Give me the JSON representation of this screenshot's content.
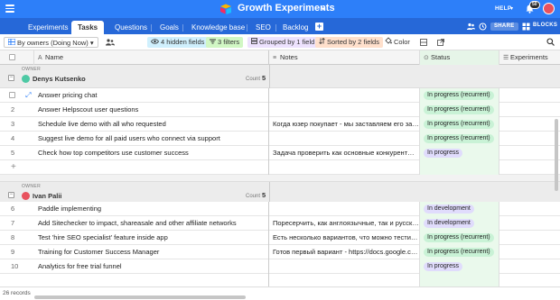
{
  "topbar": {
    "title": "Growth Experiments",
    "help_label": "HELP",
    "notification_count": "50"
  },
  "tabs": [
    {
      "label": "Experiments"
    },
    {
      "label": "Tasks"
    },
    {
      "label": "Questions"
    },
    {
      "label": "Goals"
    },
    {
      "label": "Knowledge base"
    },
    {
      "label": "SEO"
    },
    {
      "label": "Backlog"
    }
  ],
  "tabs_right": {
    "share_label": "SHARE",
    "blocks_label": "BLOCKS"
  },
  "toolbar": {
    "view_label": "By owners (Doing Now)",
    "hidden_fields": "4 hidden fields",
    "filters": "3 filters",
    "grouped": "Grouped by 1 field",
    "sorted": "Sorted by 2 fields",
    "color": "Color"
  },
  "columns": {
    "name": "Name",
    "notes": "Notes",
    "status": "Status",
    "experiments": "Experiments"
  },
  "groups": [
    {
      "owner_label": "OWNER",
      "owner": "Denys Kutsenko",
      "count_label": "Count",
      "count": "5",
      "avatar_color": "#4dc9a4",
      "rows": [
        {
          "num": "",
          "name": "Answer pricing chat",
          "notes": "",
          "status": "In progress (recurrent)"
        },
        {
          "num": "2",
          "name": "Answer Helpscout user questions",
          "notes": "",
          "status": "In progress (recurrent)"
        },
        {
          "num": "3",
          "name": "Schedule live demo with all who requested",
          "notes": "Когда юзер покупает - мы заставляем его заполн...",
          "status": "In progress (recurrent)"
        },
        {
          "num": "4",
          "name": "Suggest live demo for all paid users who connect via support",
          "notes": "",
          "status": "In progress (recurrent)"
        },
        {
          "num": "5",
          "name": "Check how top competitors use customer success",
          "notes": "Задача проверить как основные конкуренты в отр...",
          "status": "In progress"
        }
      ]
    },
    {
      "owner_label": "OWNER",
      "owner": "Ivan Palii",
      "count_label": "Count",
      "count": "5",
      "avatar_color": "#e8515d",
      "rows": [
        {
          "num": "6",
          "name": "Paddle implementing",
          "notes": "",
          "status": "In development"
        },
        {
          "num": "7",
          "name": "Add Sitechecker to impact, shareasale and other affiliate networks",
          "notes": "Поресерчить, как англоязычные, так и русскоязы...",
          "status": "In development"
        },
        {
          "num": "8",
          "name": "Test 'hire SEO specialist' feature inside app",
          "notes": "Есть несколько вариантов, что можно тестить: - т...",
          "status": "In progress (recurrent)"
        },
        {
          "num": "9",
          "name": "Training for Customer Success Manager",
          "notes": "Готов первый вариант - https://docs.google.com/...",
          "status": "In progress (recurrent)"
        },
        {
          "num": "10",
          "name": "Analytics for free trial funnel",
          "notes": "",
          "status": "In progress"
        }
      ]
    }
  ],
  "footer": {
    "records": "26 records"
  },
  "colors": {
    "topbar": "#2d7ff9",
    "tabsbar": "#2668d8",
    "pill_progress": "#c9f2d6",
    "pill_development": "#e0dcfc"
  }
}
